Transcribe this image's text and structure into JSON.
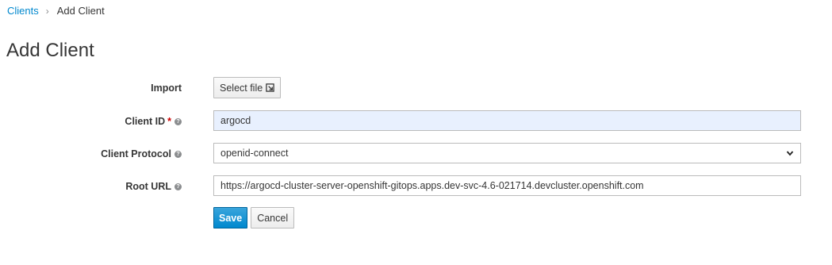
{
  "breadcrumb": {
    "parent": "Clients",
    "separator": "›",
    "current": "Add Client"
  },
  "page": {
    "title": "Add Client"
  },
  "form": {
    "import": {
      "label": "Import",
      "button_label": "Select file",
      "icon": "external-link-icon"
    },
    "client_id": {
      "label": "Client ID",
      "required_marker": "*",
      "help_icon": "question-circle-icon",
      "value": "argocd"
    },
    "client_protocol": {
      "label": "Client Protocol",
      "help_icon": "question-circle-icon",
      "selected": "openid-connect"
    },
    "root_url": {
      "label": "Root URL",
      "help_icon": "question-circle-icon",
      "value": "https://argocd-cluster-server-openshift-gitops.apps.dev-svc-4.6-021714.devcluster.openshift.com"
    }
  },
  "actions": {
    "save_label": "Save",
    "cancel_label": "Cancel"
  },
  "colors": {
    "link": "#0088ce",
    "primary": "#0088ce",
    "required": "#cc0000",
    "autofill_bg": "#e8f0fe"
  }
}
